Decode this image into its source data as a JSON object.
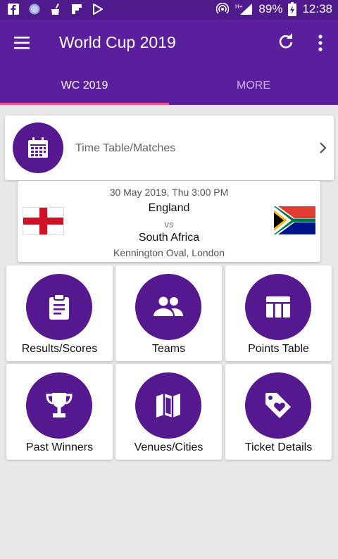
{
  "status_bar": {
    "battery": "89%",
    "time": "12:38",
    "network": "H+",
    "left_icons": [
      "facebook-icon",
      "circle-icon",
      "cleaner-icon",
      "flipboard-icon",
      "play-store-icon"
    ]
  },
  "app_bar": {
    "title": "World Cup 2019",
    "icons": [
      "menu-icon",
      "refresh-icon",
      "more-vert-icon"
    ]
  },
  "tabs": [
    {
      "label": "WC 2019",
      "selected": true
    },
    {
      "label": "MORE",
      "selected": false
    }
  ],
  "timetable": {
    "label": "Time Table/Matches",
    "icon": "calendar-icon"
  },
  "match": {
    "datetime": "30 May 2019, Thu 3:00 PM",
    "team1": "England",
    "vs": "vs",
    "team2": "South Africa",
    "venue": "Kennington Oval, London"
  },
  "tiles": [
    {
      "label": "Results/Scores",
      "icon": "clipboard-icon"
    },
    {
      "label": "Teams",
      "icon": "group-icon"
    },
    {
      "label": "Points Table",
      "icon": "table-icon"
    },
    {
      "label": "Past Winners",
      "icon": "trophy-icon"
    },
    {
      "label": "Venues/Cities",
      "icon": "map-icon"
    },
    {
      "label": "Ticket Details",
      "icon": "ticket-tag-icon"
    }
  ],
  "colors": {
    "primary": "#5b1f9e",
    "status_bar": "#4e1a8c",
    "accent": "#ff4f8e",
    "icon_circle": "#55188f"
  }
}
